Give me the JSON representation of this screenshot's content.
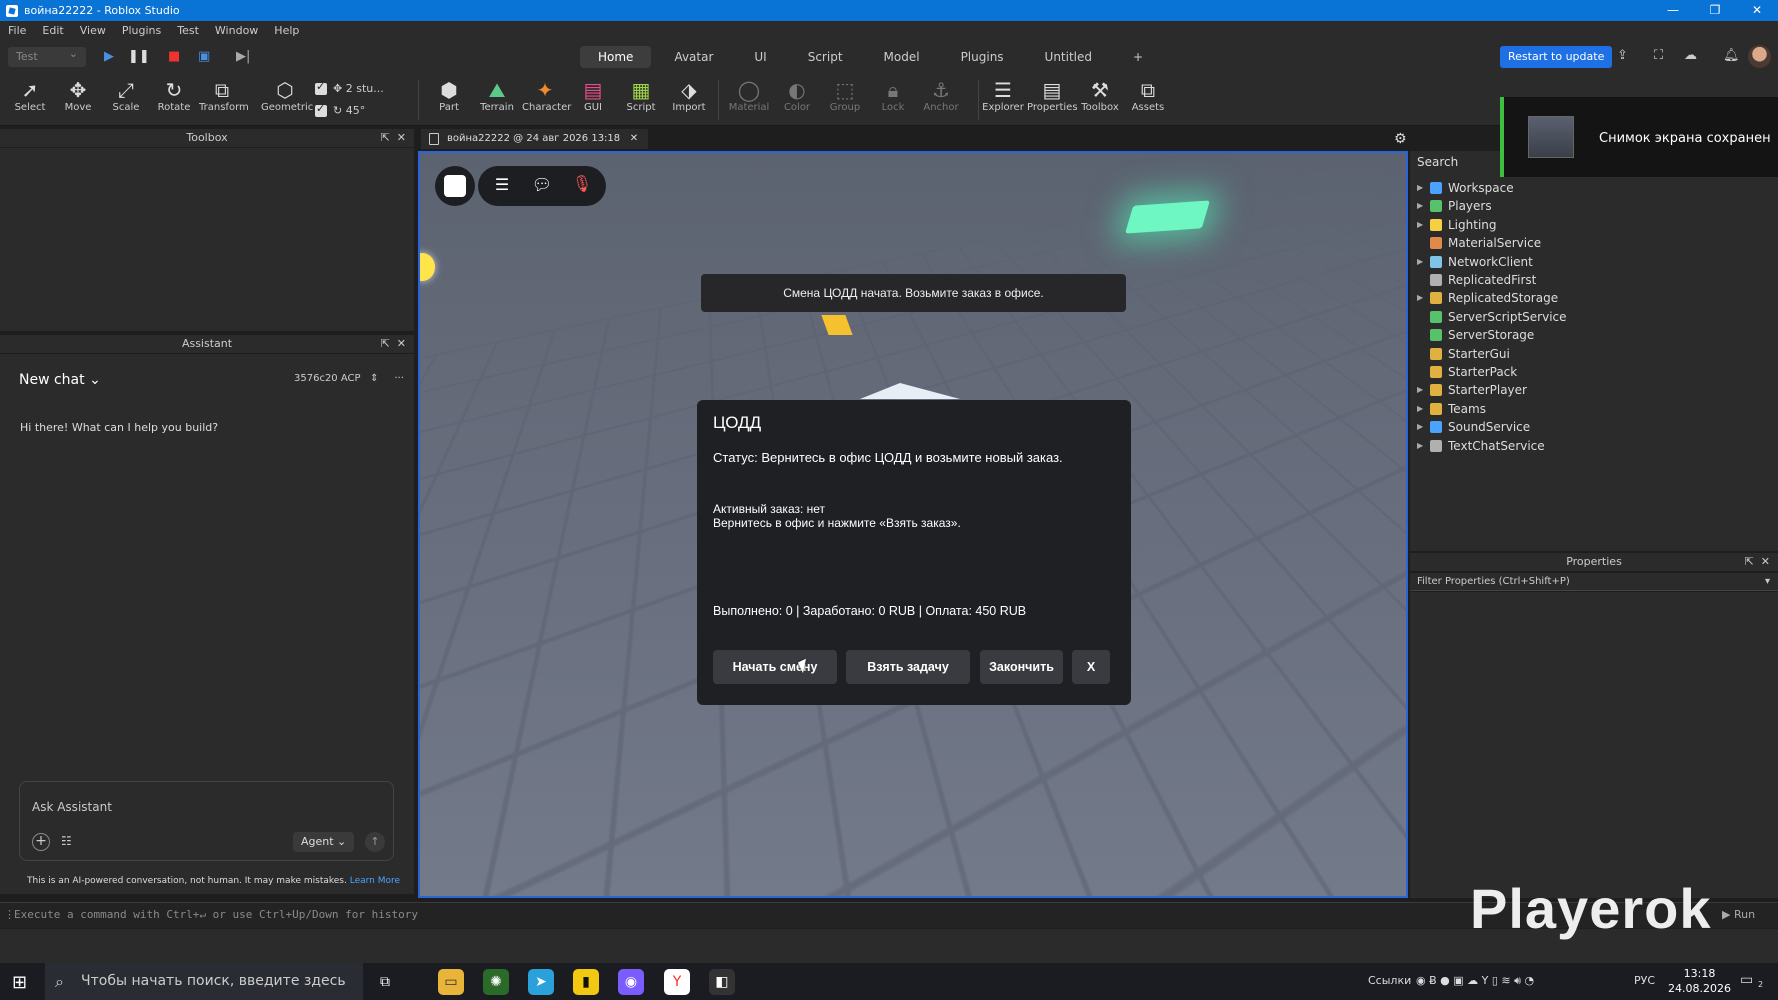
{
  "window": {
    "title": "война22222 - Roblox Studio",
    "controls": [
      "—",
      "❐",
      "✕"
    ]
  },
  "menu": [
    "File",
    "Edit",
    "View",
    "Plugins",
    "Test",
    "Window",
    "Help"
  ],
  "topbar": {
    "test_select": "Test",
    "tabs": [
      "Home",
      "Avatar",
      "UI",
      "Script",
      "Model",
      "Plugins",
      "Untitled",
      "+"
    ],
    "active_tab": "Home",
    "restart_label": "Restart to update"
  },
  "toolbar": {
    "tools": [
      "Select",
      "Move",
      "Scale",
      "Rotate",
      "Transform",
      "Geometric"
    ],
    "snap_move": "2 stu...",
    "snap_rotate": "45°",
    "insert": [
      "Part",
      "Terrain",
      "Character",
      "GUI",
      "Script",
      "Import"
    ],
    "edit": [
      "Material",
      "Color",
      "Group",
      "Lock",
      "Anchor"
    ],
    "panels": [
      "Explorer",
      "Properties",
      "Toolbox",
      "Assets"
    ]
  },
  "toolbox": {
    "title": "Toolbox"
  },
  "assistant": {
    "title": "Assistant",
    "chat_title": "New chat",
    "acp": "3576c20 ACP",
    "greeting": "Hi there! What can I help you build?",
    "input_placeholder": "Ask Assistant",
    "mode": "Agent",
    "disclaimer": "This is an AI-powered conversation, not human. It may make mistakes.",
    "learn_more": "Learn More"
  },
  "document_tab": "война22222 @ 24 авг 2026 13:18",
  "game": {
    "banner": "Смена ЦОДД начата. Возьмите заказ в офисе.",
    "dialog": {
      "title": "ЦОДД",
      "status": "Статус: Вернитесь в офис ЦОДД и возьмите новый заказ.",
      "active_order": "Активный заказ: нет",
      "hint": "Вернитесь в офис и нажмите «Взять заказ».",
      "stats": "Выполнено: 0 | Заработано: 0 RUB | Оплата: 450 RUB",
      "buttons": [
        "Начать смену",
        "Взять задачу",
        "Закончить",
        "X"
      ]
    }
  },
  "explorer": {
    "search_placeholder": "Search",
    "items": [
      {
        "label": "Workspace",
        "expandable": true,
        "color": "#4aa3ff"
      },
      {
        "label": "Players",
        "expandable": true,
        "color": "#56c26b"
      },
      {
        "label": "Lighting",
        "expandable": true,
        "color": "#f5d142"
      },
      {
        "label": "MaterialService",
        "expandable": false,
        "color": "#e08a4a"
      },
      {
        "label": "NetworkClient",
        "expandable": true,
        "color": "#7fc4e8"
      },
      {
        "label": "ReplicatedFirst",
        "expandable": false,
        "color": "#b0b0b0"
      },
      {
        "label": "ReplicatedStorage",
        "expandable": true,
        "color": "#e0b040"
      },
      {
        "label": "ServerScriptService",
        "expandable": false,
        "color": "#56c26b"
      },
      {
        "label": "ServerStorage",
        "expandable": false,
        "color": "#56c26b"
      },
      {
        "label": "StarterGui",
        "expandable": false,
        "color": "#e0b040"
      },
      {
        "label": "StarterPack",
        "expandable": false,
        "color": "#e0b040"
      },
      {
        "label": "StarterPlayer",
        "expandable": true,
        "color": "#e0b040"
      },
      {
        "label": "Teams",
        "expandable": true,
        "color": "#e0b040"
      },
      {
        "label": "SoundService",
        "expandable": true,
        "color": "#4aa3ff"
      },
      {
        "label": "TextChatService",
        "expandable": true,
        "color": "#b0b0b0"
      }
    ]
  },
  "toast": {
    "message": "Снимок экрана сохранен"
  },
  "properties": {
    "title": "Properties",
    "filter_placeholder": "Filter Properties (Ctrl+Shift+P)"
  },
  "command_bar": {
    "placeholder": "Execute a command with Ctrl+↵ or use Ctrl+Up/Down for history",
    "run": "▶ Run"
  },
  "watermark": "Playerok",
  "taskbar": {
    "search_placeholder": "Чтобы начать поиск, введите здесь запрос",
    "links": "Ссылки",
    "lang": "РУС",
    "time": "13:18",
    "date": "24.08.2026",
    "notifications": "2"
  }
}
